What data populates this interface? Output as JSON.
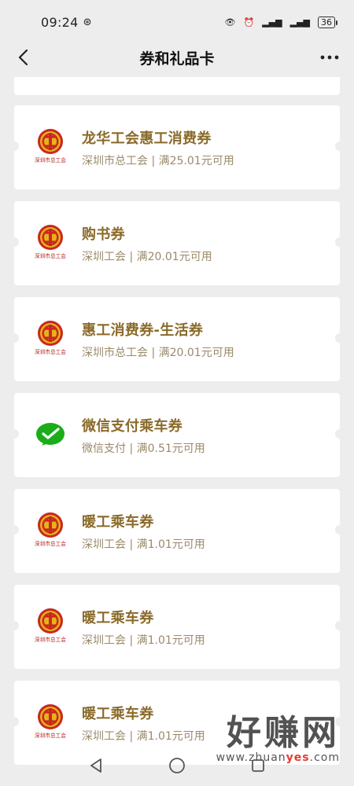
{
  "status": {
    "time": "09:24",
    "battery": "36"
  },
  "header": {
    "title": "券和礼品卡",
    "back_icon": "chevron-left-icon",
    "more_icon": "ellipsis-icon"
  },
  "coupons": [
    {
      "name": "龙华工会惠工消费券",
      "subtitle": "深圳市总工会 | 满25.01元可用",
      "logo": "union-logo",
      "logo_text": "深圳市总工会"
    },
    {
      "name": "购书券",
      "subtitle": "深圳工会 | 满20.01元可用",
      "logo": "union-logo",
      "logo_text": "深圳市总工会"
    },
    {
      "name": "惠工消费券-生活券",
      "subtitle": "深圳市总工会 | 满20.01元可用",
      "logo": "union-logo",
      "logo_text": "深圳市总工会"
    },
    {
      "name": "微信支付乘车券",
      "subtitle": "微信支付 | 满0.51元可用",
      "logo": "wechat-pay-logo"
    },
    {
      "name": "暖工乘车券",
      "subtitle": "深圳工会 | 满1.01元可用",
      "logo": "union-logo",
      "logo_text": "深圳市总工会"
    },
    {
      "name": "暖工乘车券",
      "subtitle": "深圳工会 | 满1.01元可用",
      "logo": "union-logo",
      "logo_text": "深圳市总工会"
    },
    {
      "name": "暖工乘车券",
      "subtitle": "深圳工会 | 满1.01元可用",
      "logo": "union-logo",
      "logo_text": "深圳市总工会"
    }
  ],
  "watermark": {
    "text": "好赚网",
    "url_pre": "www.zhuan",
    "url_hl": "yes",
    "url_post": ".com"
  },
  "colors": {
    "coupon_title": "#8a6a2a",
    "union_red": "#c8281f",
    "union_gold": "#e7b21a",
    "wechat_green": "#1aad19"
  }
}
